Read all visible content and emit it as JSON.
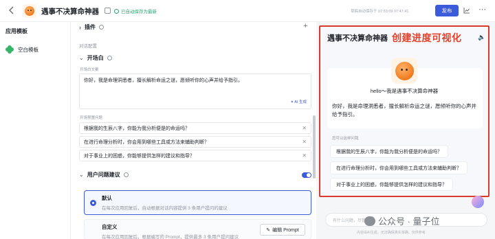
{
  "header": {
    "title": "遇事不决算命神器",
    "save_status": "已自动保存为最新",
    "autosave_text": "草稿自动保存于 07:53:09 07:47:41",
    "publish_label": "发布"
  },
  "sidebar": {
    "title": "应用模板",
    "items": [
      {
        "label": "空白模板"
      }
    ]
  },
  "config": {
    "plugin_label": "插件",
    "section_label": "对话配置",
    "opening": {
      "label": "开场白",
      "text_label": "开场白文案",
      "text": "你好，我是命理洞悉者，擅长解析命运之谜，愿倾听你的心声并给予指引。",
      "ai_generate": "✦ AI 生成",
      "questions_label": "开场预置问题",
      "questions": [
        "根据我的生辰八字，你能为我分析便是的命运吗？",
        "在进行命理分析时，你会用到哪些工具或方法来辅助判断？",
        "对于事业上的困惑，你能够提供怎样的建议和指导？"
      ]
    },
    "suggestions": {
      "label": "用户问题建议",
      "enabled": true,
      "options": [
        {
          "title": "默认",
          "desc": "在每次应用回复后，自动根据对话内容提供 3 条用户提问的建议",
          "selected": true
        },
        {
          "title": "自定义",
          "desc": "在每次应用回复后，根据编写的 Prompt，提供最多 3 条用户提问建议",
          "selected": false
        }
      ],
      "edit_prompt": "编辑 Prompt"
    }
  },
  "preview": {
    "title": "遇事不决算命神器",
    "callout": "创建进度可视化",
    "hello": "hello～我是遇事不决算命神器",
    "intro": "你好，我是命理洞悉者，擅长解析命运之谜，愿倾听你的心声并给予指引。",
    "ask_label": "您可以这样问我",
    "questions": [
      "根据我的生辰八字，你能为我分析便是的命运吗？",
      "在进行命理分析时，你会用到哪些工具或方法来辅助判断？",
      "对于事业上的困惑，你能够提供怎样的建议和指导？"
    ],
    "input_placeholder": "有什么问题，尽管问我",
    "footer": "内容由AI生成，无法确保真实准确，仅供参考"
  },
  "watermark": {
    "text": "公众号 · 量子位"
  },
  "colors": {
    "accent": "#3b5bdb",
    "highlight_border": "#d93a2b",
    "callout": "#e0442f",
    "success": "#2ba471"
  }
}
